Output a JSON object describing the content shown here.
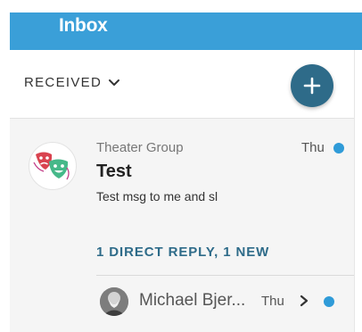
{
  "header": {
    "title": "Inbox",
    "color": "#3a9fd8"
  },
  "filter": {
    "label": "RECEIVED",
    "icon": "chevron-down-icon"
  },
  "compose": {
    "icon": "plus-icon",
    "color": "#2e6b89"
  },
  "message": {
    "sender": "Theater Group",
    "date": "Thu",
    "unread": true,
    "subject": "Test",
    "preview": "Test msg to me and sl",
    "avatar_icon": "theater-masks-icon",
    "reply_summary": "1 DIRECT REPLY, 1 NEW",
    "replies": [
      {
        "name": "Michael Bjer...",
        "date": "Thu",
        "unread": true,
        "icon": "chevron-right-icon"
      }
    ]
  },
  "colors": {
    "accent": "#2e6b89",
    "unread_dot": "#2f9bd8",
    "message_bg": "#f5f5f5"
  }
}
